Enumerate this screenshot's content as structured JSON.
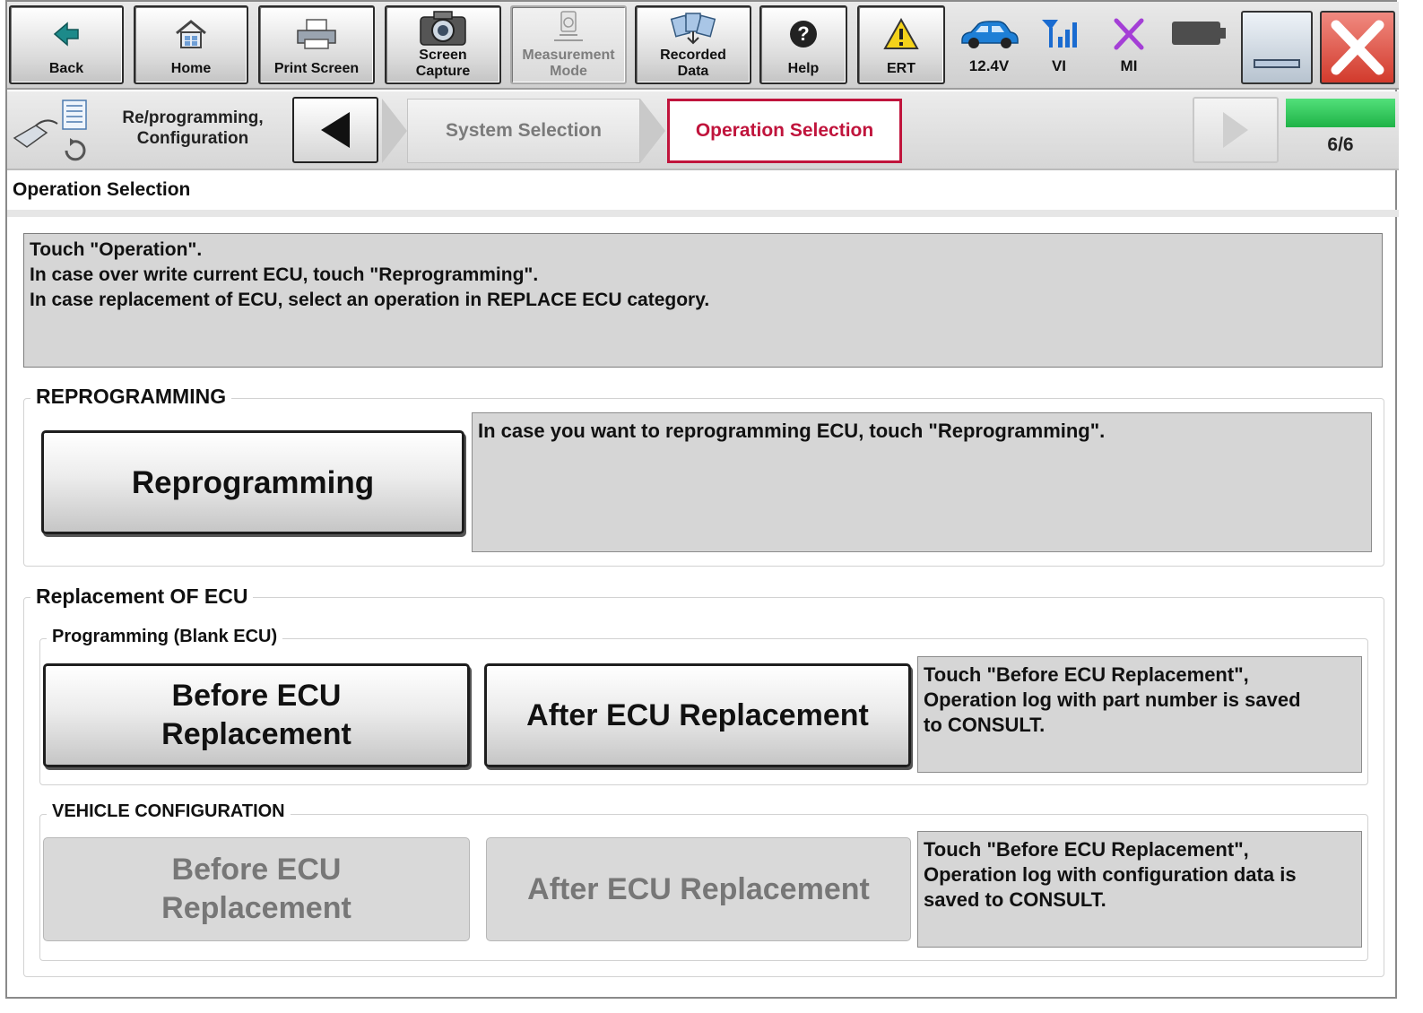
{
  "toolbar": {
    "back": "Back",
    "home": "Home",
    "print_screen": "Print Screen",
    "screen_capture": "Screen\nCapture",
    "measurement_mode": "Measurement\nMode",
    "recorded_data": "Recorded\nData",
    "help": "Help",
    "ert": "ERT",
    "battery_voltage": "12.4V",
    "vi": "VI",
    "mi": "MI"
  },
  "nav": {
    "section_title": "Re/programming,\nConfiguration",
    "crumbs": [
      "System Selection",
      "Operation Selection"
    ],
    "step_text": "6/6",
    "progress": 1.0
  },
  "page": {
    "title": "Operation Selection",
    "instructions": "Touch \"Operation\".\nIn case over write current ECU, touch \"Reprogramming\".\nIn case replacement of ECU, select an operation in REPLACE ECU category."
  },
  "reprogramming": {
    "legend": "REPROGRAMMING",
    "button": "Reprogramming",
    "description": "In case you want to reprogramming ECU, touch \"Reprogramming\"."
  },
  "replacement": {
    "legend": "Replacement OF ECU",
    "programming": {
      "legend": "Programming (Blank ECU)",
      "before_button": "Before ECU\nReplacement",
      "after_button": "After ECU Replacement",
      "description": "Touch \"Before ECU Replacement\",\nOperation log with part number is saved\nto CONSULT."
    },
    "vehicle_configuration": {
      "legend": "VEHICLE CONFIGURATION",
      "before_button": "Before ECU\nReplacement",
      "after_button": "After ECU Replacement",
      "description": "Touch \"Before ECU Replacement\",\nOperation log with configuration data is\nsaved to CONSULT."
    }
  },
  "colors": {
    "accent": "#c0143c",
    "progress": "#2ec65a",
    "panel": "#d6d6d6"
  }
}
